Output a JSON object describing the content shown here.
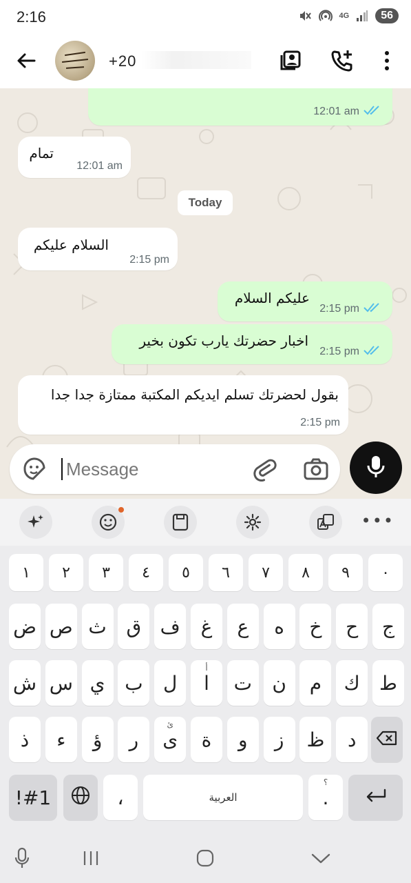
{
  "status_bar": {
    "time": "2:16",
    "network_label": "4G",
    "battery": "56",
    "icons": [
      "mute-icon",
      "hotspot-icon",
      "network-icon",
      "signal-icon",
      "battery-icon"
    ]
  },
  "header": {
    "contact_name": "+20",
    "icons": [
      "back-arrow-icon",
      "contact-card-icon",
      "add-call-icon",
      "more-vert-icon"
    ]
  },
  "chat": {
    "messages": [
      {
        "direction": "out",
        "text": "",
        "time": "12:01 am",
        "ticks": true
      },
      {
        "direction": "in",
        "text": "تمام",
        "time": "12:01 am"
      },
      {
        "direction": "in",
        "text": "السلام عليكم",
        "time": "2:15 pm"
      },
      {
        "direction": "out",
        "text": "عليكم السلام",
        "time": "2:15 pm",
        "ticks": true
      },
      {
        "direction": "out",
        "text": "اخبار حضرتك يارب تكون بخير",
        "time": "2:15 pm",
        "ticks": true
      },
      {
        "direction": "in",
        "text": "بقول لحضرتك تسلم ايديكم المكتبة ممتازة جدا جدا",
        "time": "2:15 pm"
      }
    ],
    "date_divider": "Today",
    "tick_color": "#53bdeb"
  },
  "composer": {
    "placeholder": "Message",
    "value": ""
  },
  "keyboard": {
    "row_numbers": [
      "١",
      "٢",
      "٣",
      "٤",
      "٥",
      "٦",
      "٧",
      "٨",
      "٩",
      "٠"
    ],
    "row1": [
      "ض",
      "ص",
      "ث",
      "ق",
      "ف",
      "غ",
      "ع",
      "ه",
      "خ",
      "ح",
      "ج"
    ],
    "row2": [
      "ش",
      "س",
      "ي",
      "ب",
      "ل",
      "ا",
      "ت",
      "ن",
      "م",
      "ك",
      "ط"
    ],
    "row2_sup": [
      "",
      "",
      "",
      "",
      "",
      "أ",
      "",
      "",
      "",
      "",
      ""
    ],
    "row3": [
      "ذ",
      "ء",
      "ؤ",
      "ر",
      "ى",
      "ة",
      "و",
      "ز",
      "ظ",
      "د"
    ],
    "row3_sup": [
      "",
      "",
      "",
      "",
      "ئ",
      "",
      "",
      "",
      "",
      ""
    ],
    "symbols_label": "!#1",
    "comma": "،",
    "space_label": "العربية",
    "period": ".",
    "period_sup": "؟"
  },
  "colors": {
    "chat_bg": "#efeae2",
    "outgoing_bubble": "#d9fdd3",
    "incoming_bubble": "#ffffff",
    "mic_button": "#111111"
  }
}
